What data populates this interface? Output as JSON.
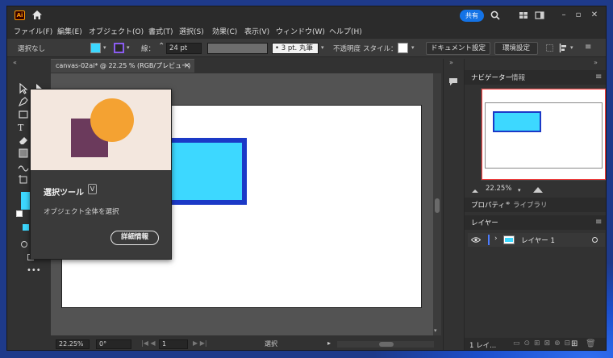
{
  "app": {
    "logo_text": "Ai",
    "share_label": "共有"
  },
  "menu": [
    "ファイル(F)",
    "編集(E)",
    "オブジェクト(O)",
    "書式(T)",
    "選択(S)",
    "効果(C)",
    "表示(V)",
    "ウィンドウ(W)",
    "ヘルプ(H)"
  ],
  "control": {
    "selection_status": "選択なし",
    "stroke_label": "線：",
    "stroke_value": "24 pt",
    "brush_value": "3 pt. 丸筆",
    "opacity_label": "不透明度",
    "style_label": "スタイル：",
    "document_setup": "ドキュメント設定",
    "preferences": "環境設定"
  },
  "document": {
    "tab_title": "canvas-02ai* @ 22.25 % (RGB/プレビュー)",
    "close": "×"
  },
  "status": {
    "zoom": "22.25%",
    "rotation": "0°",
    "artboard": "1",
    "tool": "選択"
  },
  "navigator": {
    "tabs": [
      "ナビゲーター",
      "情報"
    ],
    "zoom": "22.25%"
  },
  "properties": {
    "tabs": [
      "プロパティ",
      "ライブラリ"
    ]
  },
  "layers": {
    "title": "レイヤー",
    "items": [
      {
        "name": "レイヤー 1"
      }
    ],
    "footer": "1 レイ..."
  },
  "tooltip": {
    "title": "選択ツール",
    "shortcut": "V",
    "description": "オブジェクト全体を選択",
    "button": "詳細情報"
  },
  "colors": {
    "fill": "#3dd8ff",
    "rect_stroke": "#1b39c7",
    "circle": "#f4a232",
    "square": "#6b3a5c",
    "accent": "#1473e6"
  }
}
